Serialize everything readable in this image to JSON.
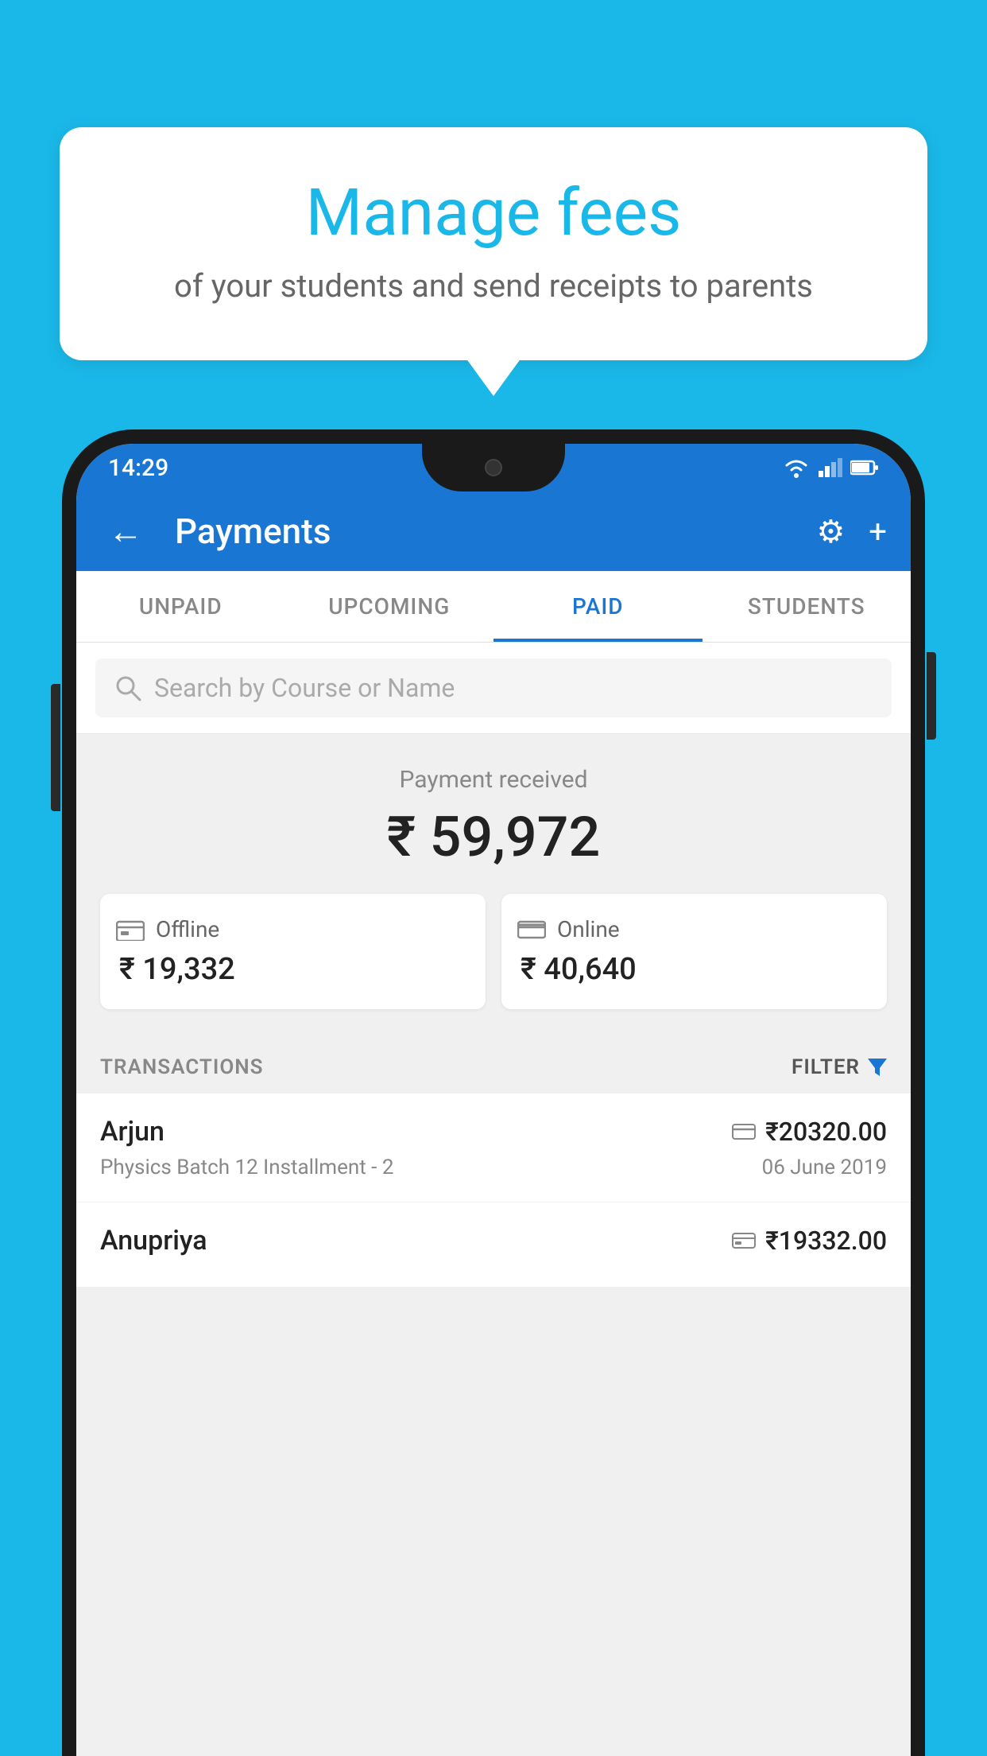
{
  "background_color": "#1ab8e8",
  "speech_bubble": {
    "title": "Manage fees",
    "subtitle": "of your students and send receipts to parents"
  },
  "status_bar": {
    "time": "14:29"
  },
  "app_bar": {
    "title": "Payments",
    "back_label": "←",
    "gear_label": "⚙",
    "plus_label": "+"
  },
  "tabs": [
    {
      "label": "UNPAID",
      "active": false
    },
    {
      "label": "UPCOMING",
      "active": false
    },
    {
      "label": "PAID",
      "active": true
    },
    {
      "label": "STUDENTS",
      "active": false
    }
  ],
  "search": {
    "placeholder": "Search by Course or Name"
  },
  "payment_summary": {
    "label": "Payment received",
    "amount": "₹ 59,972",
    "offline": {
      "label": "Offline",
      "amount": "₹ 19,332"
    },
    "online": {
      "label": "Online",
      "amount": "₹ 40,640"
    }
  },
  "transactions": {
    "label": "TRANSACTIONS",
    "filter_label": "FILTER",
    "items": [
      {
        "name": "Arjun",
        "amount": "₹20320.00",
        "description": "Physics Batch 12 Installment - 2",
        "date": "06 June 2019",
        "type": "online"
      },
      {
        "name": "Anupriya",
        "amount": "₹19332.00",
        "description": "",
        "date": "",
        "type": "offline"
      }
    ]
  }
}
